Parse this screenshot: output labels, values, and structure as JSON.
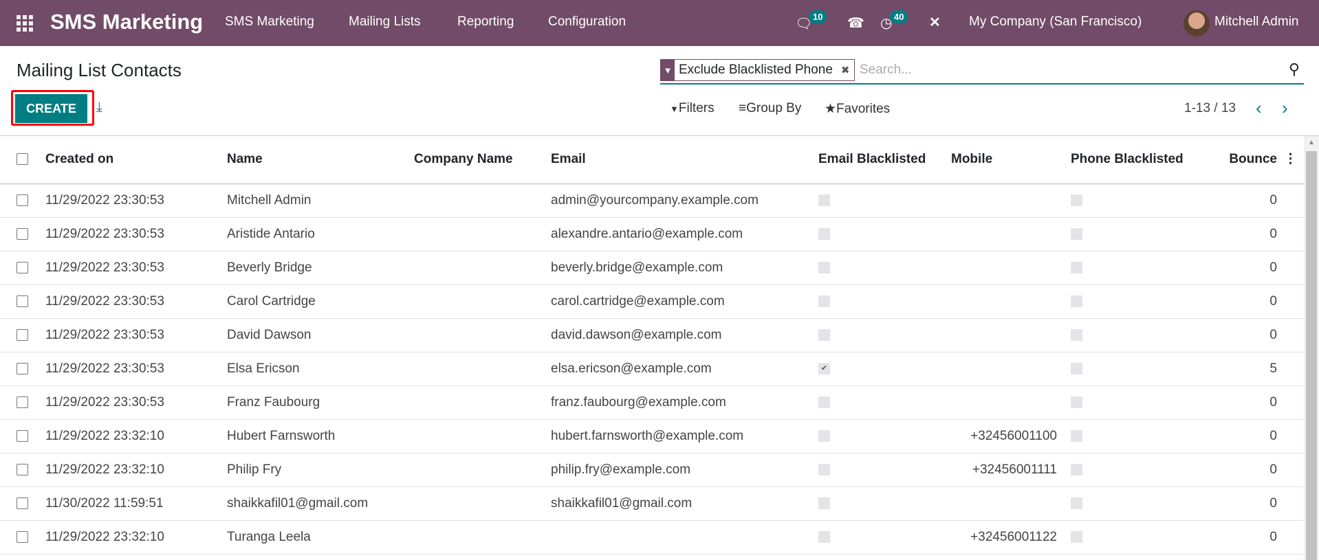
{
  "nav": {
    "brand": "SMS Marketing",
    "menu": [
      "SMS Marketing",
      "Mailing Lists",
      "Reporting",
      "Configuration"
    ],
    "messages_count": "10",
    "activities_count": "40",
    "company": "My Company (San Francisco)",
    "user": "Mitchell Admin"
  },
  "page": {
    "title": "Mailing List Contacts",
    "create_label": "CREATE"
  },
  "search": {
    "facet": "Exclude Blacklisted Phone",
    "placeholder": "Search..."
  },
  "options": {
    "filters": "Filters",
    "group_by": "Group By",
    "favorites": "Favorites"
  },
  "pager": {
    "text": "1-13 / 13"
  },
  "colors": {
    "brand": "#714B67",
    "accent": "#017e84"
  },
  "table": {
    "columns": [
      "Created on",
      "Name",
      "Company Name",
      "Email",
      "Email Blacklisted",
      "Mobile",
      "Phone Blacklisted",
      "Bounce"
    ],
    "rows": [
      {
        "created": "11/29/2022 23:30:53",
        "name": "Mitchell Admin",
        "company": "",
        "email": "admin@yourcompany.example.com",
        "email_bl": false,
        "mobile": "",
        "phone_bl": false,
        "bounce": "0"
      },
      {
        "created": "11/29/2022 23:30:53",
        "name": "Aristide Antario",
        "company": "",
        "email": "alexandre.antario@example.com",
        "email_bl": false,
        "mobile": "",
        "phone_bl": false,
        "bounce": "0"
      },
      {
        "created": "11/29/2022 23:30:53",
        "name": "Beverly Bridge",
        "company": "",
        "email": "beverly.bridge@example.com",
        "email_bl": false,
        "mobile": "",
        "phone_bl": false,
        "bounce": "0"
      },
      {
        "created": "11/29/2022 23:30:53",
        "name": "Carol Cartridge",
        "company": "",
        "email": "carol.cartridge@example.com",
        "email_bl": false,
        "mobile": "",
        "phone_bl": false,
        "bounce": "0"
      },
      {
        "created": "11/29/2022 23:30:53",
        "name": "David Dawson",
        "company": "",
        "email": "david.dawson@example.com",
        "email_bl": false,
        "mobile": "",
        "phone_bl": false,
        "bounce": "0"
      },
      {
        "created": "11/29/2022 23:30:53",
        "name": "Elsa Ericson",
        "company": "",
        "email": "elsa.ericson@example.com",
        "email_bl": true,
        "mobile": "",
        "phone_bl": false,
        "bounce": "5"
      },
      {
        "created": "11/29/2022 23:30:53",
        "name": "Franz Faubourg",
        "company": "",
        "email": "franz.faubourg@example.com",
        "email_bl": false,
        "mobile": "",
        "phone_bl": false,
        "bounce": "0"
      },
      {
        "created": "11/29/2022 23:32:10",
        "name": "Hubert Farnsworth",
        "company": "",
        "email": "hubert.farnsworth@example.com",
        "email_bl": false,
        "mobile": "+32456001100",
        "phone_bl": false,
        "bounce": "0"
      },
      {
        "created": "11/29/2022 23:32:10",
        "name": "Philip Fry",
        "company": "",
        "email": "philip.fry@example.com",
        "email_bl": false,
        "mobile": "+32456001111",
        "phone_bl": false,
        "bounce": "0"
      },
      {
        "created": "11/30/2022 11:59:51",
        "name": "shaikkafil01@gmail.com",
        "company": "",
        "email": "shaikkafil01@gmail.com",
        "email_bl": false,
        "mobile": "",
        "phone_bl": false,
        "bounce": "0"
      },
      {
        "created": "11/29/2022 23:32:10",
        "name": "Turanga Leela",
        "company": "",
        "email": "",
        "email_bl": false,
        "mobile": "+32456001122",
        "phone_bl": false,
        "bounce": "0"
      }
    ]
  }
}
